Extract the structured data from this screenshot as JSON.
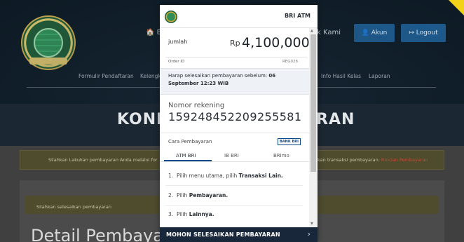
{
  "background": {
    "nav_home": "🏠 B",
    "nav_kontak": "k Kami",
    "akun_label": "👤 Akun",
    "logout_label": "↦ Logout",
    "menu_items": [
      "Formulir Pendaftaran",
      "Kelengk",
      "Info Hasil Kelas",
      "Laporan"
    ],
    "hero_left": "KONF",
    "hero_right": "RAN",
    "alert_left": "Silahkan Lakukan pembayaran Anda melalui for",
    "alert_right": "kan transaksi pembayaran.",
    "alert_link": "Rincian Pembayaran",
    "card_note": "Silahkan selesaikan pembayaran",
    "detail_title": "Detail Pembayaı"
  },
  "popup": {
    "title": "BRI ATM",
    "amount_label": "jumlah",
    "currency": "Rp",
    "amount": "4,100,000",
    "order_label": "Order ID",
    "order_value": "REG026",
    "deadline_prefix": "Harap selesaikan pembayaran sebelum:",
    "deadline_date": "06 September 12:23 WIB",
    "rek_label": "Nomor rekening",
    "rek_value": "159248452209255581",
    "cara_label": "Cara Pembayaran",
    "bank_logo": "BANK BRI",
    "tabs": [
      "ATM BRI",
      "IB BRI",
      "BRImo"
    ],
    "steps": [
      {
        "num": "1.",
        "text": "Pilih menu utama, pilih",
        "bold": "Transaksi Lain."
      },
      {
        "num": "2.",
        "text": "Pilih",
        "bold": "Pembayaran."
      },
      {
        "num": "3.",
        "text": "Pilih",
        "bold": "Lainnya."
      }
    ],
    "footer": "MOHON SELESAIKAN PEMBAYARAN",
    "footer_chevron": "›"
  },
  "colors": {
    "navbar": "#0d1a24",
    "button_blue": "#1c5b8f",
    "bri_blue": "#0b4a8b",
    "footer_bar": "#18283a",
    "alert_link": "#c14b3a"
  }
}
